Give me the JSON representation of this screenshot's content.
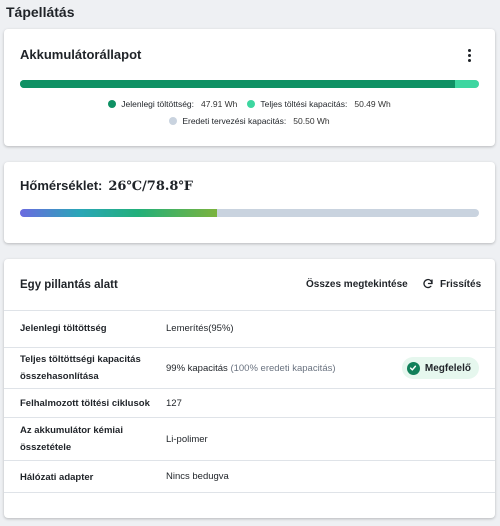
{
  "page": {
    "title": "Tápellátás"
  },
  "battery": {
    "title": "Akkumulátorállapot",
    "menu_icon": "more-vertical-icon",
    "bar": {
      "current_fraction": 0.948,
      "full_fraction": 0.9998
    },
    "legend": [
      {
        "label": "Jelenlegi töltöttség:",
        "value": "47.91 Wh",
        "color": "#0f9164"
      },
      {
        "label": "Teljes töltési kapacitás:",
        "value": "50.49 Wh",
        "color": "#3dd6a0"
      },
      {
        "label": "Eredeti tervezési kapacitás:",
        "value": "50.50 Wh",
        "color": "#c9d3df"
      }
    ]
  },
  "temperature": {
    "title": "Hőmérséklet:",
    "value": "26℃/78.8℉",
    "fill_fraction": 0.43
  },
  "glance": {
    "title": "Egy pillantás alatt",
    "view_all": "Összes megtekintése",
    "refresh": "Frissítés",
    "refresh_icon": "refresh-icon",
    "rows": [
      {
        "label": "Jelenlegi töltöttség",
        "value": "Lemerítés(95%)"
      },
      {
        "label": "Teljes töltöttségi kapacitás összehasonlítása",
        "value": "99% kapacitás",
        "value_muted": "(100% eredeti kapacitás)",
        "badge": "Megfelelő"
      },
      {
        "label": "Felhalmozott töltési ciklusok",
        "value": "127"
      },
      {
        "label": "Az akkumulátor kémiai összetétele",
        "value": "Li-polimer"
      },
      {
        "label": "Hálózati adapter",
        "value": "Nincs bedugva"
      }
    ]
  }
}
